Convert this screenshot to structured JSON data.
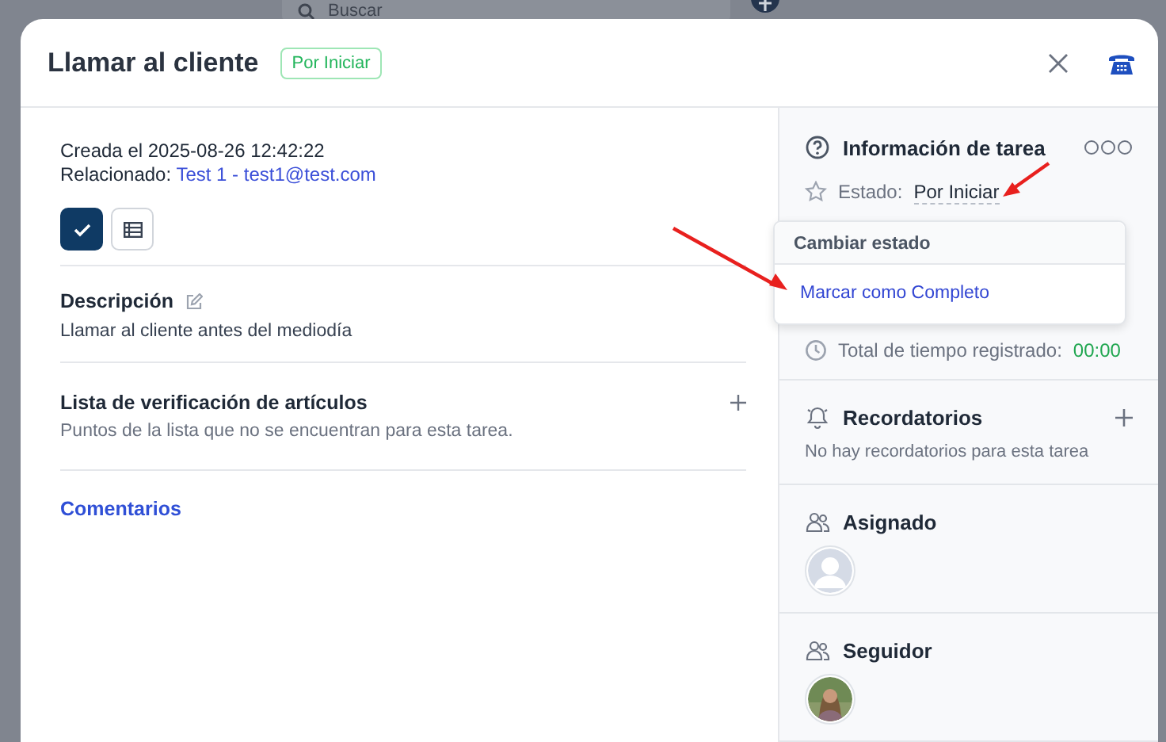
{
  "backdrop": {
    "search": {
      "placeholder": "Buscar"
    }
  },
  "modal": {
    "title": "Llamar al cliente",
    "status_badge": "Por Iniciar"
  },
  "details": {
    "created": "Creada el 2025-08-26 12:42:22",
    "related_label": "Relacionado:",
    "related_link": "Test 1 - test1@test.com"
  },
  "view_toggles": [
    {
      "kind": "check",
      "selected": true
    },
    {
      "kind": "table",
      "selected": false
    }
  ],
  "description": {
    "title": "Descripción",
    "text": "Llamar al cliente antes del mediodía"
  },
  "checklist": {
    "title": "Lista de verificación de artículos",
    "empty": "Puntos de la lista que no se encuentran para esta tarea."
  },
  "comments": {
    "title": "Comentarios"
  },
  "task_info": {
    "title": "Información de tarea",
    "status_label": "Estado:",
    "status_value": "Por Iniciar",
    "time_label": "Total de tiempo registrado:",
    "time_value": "00:00"
  },
  "status_menu": {
    "title": "Cambiar estado",
    "items": [
      "Marcar como Completo"
    ]
  },
  "reminders": {
    "title": "Recordatorios",
    "empty": "No hay recordatorios para esta tarea"
  },
  "assigned": {
    "title": "Asignado",
    "avatars": [
      {
        "kind": "placeholder"
      }
    ]
  },
  "followers": {
    "title": "Seguidor",
    "avatars": [
      {
        "kind": "photo"
      }
    ]
  }
}
